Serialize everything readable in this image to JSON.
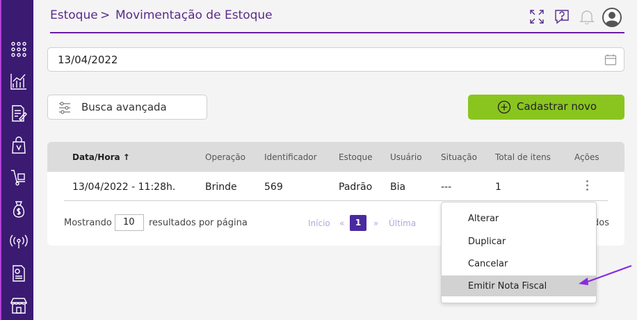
{
  "breadcrumb": {
    "parent": "Estoque",
    "separator": ">",
    "current": "Movimentação de Estoque"
  },
  "date_filter": {
    "value": "13/04/2022"
  },
  "buttons": {
    "advanced_search": "Busca avançada",
    "create_new": "Cadastrar novo"
  },
  "table": {
    "headers": [
      "Data/Hora",
      "Operação",
      "Identificador",
      "Estoque",
      "Usuário",
      "Situação",
      "Total de itens",
      "Ações"
    ],
    "sort_indicator": "↑",
    "rows": [
      {
        "datetime": "13/04/2022 - 11:28h.",
        "operation": "Brinde",
        "identifier": "569",
        "stock": "Padrão",
        "user": "Bia",
        "status": "---",
        "total_items": "1"
      }
    ]
  },
  "pagination": {
    "showing_label": "Mostrando",
    "per_page": "10",
    "per_page_suffix": "resultados por página",
    "first": "Início",
    "prev": "«",
    "current_page": "1",
    "next": "»",
    "last": "Última",
    "trailing_text": "dos"
  },
  "actions_menu": {
    "items": [
      "Alterar",
      "Duplicar",
      "Cancelar",
      "Emitir Nota Fiscal"
    ],
    "highlighted": "Emitir Nota Fiscal"
  },
  "colors": {
    "sidebar": "#3b1a72",
    "accent": "#6a1aa6",
    "primary_button": "#8ac51f",
    "annotation_arrow": "#8a2be2"
  },
  "sidebar_icons": [
    "apps-grid-icon",
    "chart-icon",
    "document-edit-icon",
    "shopping-bag-icon",
    "hand-truck-icon",
    "money-bag-icon",
    "broadcast-icon",
    "report-icon",
    "store-icon"
  ],
  "header_icons": [
    "fullscreen-icon",
    "help-chat-icon",
    "bell-icon",
    "user-avatar-icon"
  ]
}
